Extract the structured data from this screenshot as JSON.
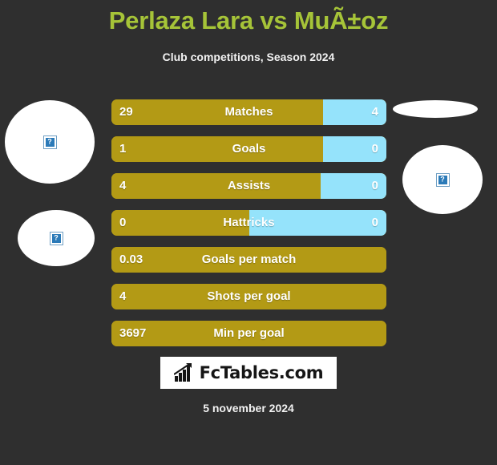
{
  "header": {
    "title": "Perlaza Lara vs MuÃ±oz",
    "subtitle": "Club competitions, Season 2024",
    "title_color": "#a6c438"
  },
  "theme": {
    "background": "#2f2f2f",
    "home_color": "#b39a15",
    "away_color": "#95e3fb",
    "text_color": "#ffffff"
  },
  "photos": [
    {
      "name": "home-player-photo-primary",
      "alt": "broken-image"
    },
    {
      "name": "home-player-photo-secondary",
      "alt": "broken-image"
    },
    {
      "name": "away-player-photo-primary",
      "alt": "broken-image"
    },
    {
      "name": "away-player-photo-secondary",
      "alt": "broken-image"
    }
  ],
  "stats": [
    {
      "label": "Matches",
      "home": "29",
      "away": "4",
      "home_pct": 77,
      "away_pct": 23,
      "has_away": true
    },
    {
      "label": "Goals",
      "home": "1",
      "away": "0",
      "home_pct": 77,
      "away_pct": 23,
      "has_away": true
    },
    {
      "label": "Assists",
      "home": "4",
      "away": "0",
      "home_pct": 76,
      "away_pct": 24,
      "has_away": true
    },
    {
      "label": "Hattricks",
      "home": "0",
      "away": "0",
      "home_pct": 50,
      "away_pct": 50,
      "has_away": true
    },
    {
      "label": "Goals per match",
      "home": "0.03",
      "away": "",
      "home_pct": 100,
      "away_pct": 0,
      "has_away": false
    },
    {
      "label": "Shots per goal",
      "home": "4",
      "away": "",
      "home_pct": 100,
      "away_pct": 0,
      "has_away": false
    },
    {
      "label": "Min per goal",
      "home": "3697",
      "away": "",
      "home_pct": 100,
      "away_pct": 0,
      "has_away": false
    }
  ],
  "footer": {
    "logo_text": "FcTables.com",
    "logo_icon": "bar-chart-growth-icon",
    "date": "5 november 2024"
  }
}
